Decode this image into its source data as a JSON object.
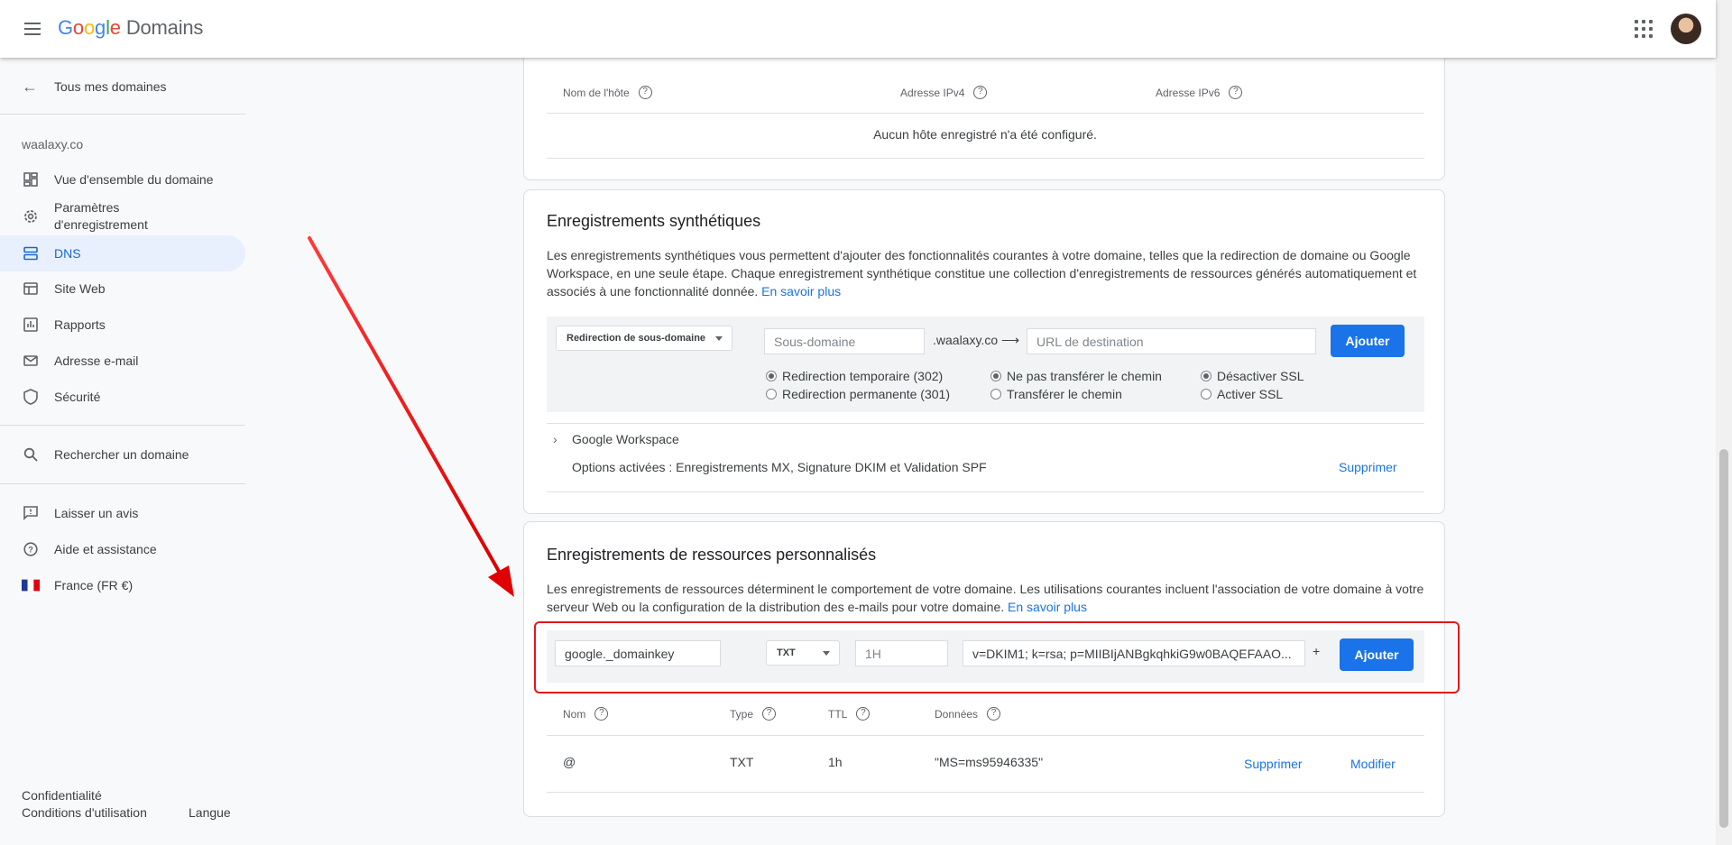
{
  "header": {
    "logo_brand": "Google",
    "logo_product": "Domains"
  },
  "sidebar": {
    "back_label": "Tous mes domaines",
    "domain": "waalaxy.co",
    "items": [
      {
        "label": "Vue d'ensemble du domaine",
        "icon": "dashboard-icon"
      },
      {
        "label": "Paramètres d'enregistrement",
        "icon": "gear-icon"
      },
      {
        "label": "DNS",
        "icon": "dns-icon",
        "active": true
      },
      {
        "label": "Site Web",
        "icon": "web-icon"
      },
      {
        "label": "Rapports",
        "icon": "reports-icon"
      },
      {
        "label": "Adresse e-mail",
        "icon": "mail-icon"
      },
      {
        "label": "Sécurité",
        "icon": "shield-icon"
      }
    ],
    "search_label": "Rechercher un domaine",
    "feedback_label": "Laisser un avis",
    "help_label": "Aide et assistance",
    "country_label": "France (FR €)",
    "footer": {
      "privacy": "Confidentialité",
      "terms": "Conditions d'utilisation",
      "language": "Langue"
    }
  },
  "hosts": {
    "columns": [
      "Nom de l'hôte",
      "Adresse IPv4",
      "Adresse IPv6"
    ],
    "empty_message": "Aucun hôte enregistré n'a été configuré."
  },
  "synthetic": {
    "title": "Enregistrements synthétiques",
    "description": "Les enregistrements synthétiques vous permettent d'ajouter des fonctionnalités courantes à votre domaine, telles que la redirection de domaine ou Google Workspace, en une seule étape. Chaque enregistrement synthétique constitue une collection d'enregistrements de ressources générés automatiquement et associés à une fonctionnalité donnée.",
    "learn_more": "En savoir plus",
    "type_select": "Redirection de sous-domaine",
    "subdomain_placeholder": "Sous-domaine",
    "domain_suffix": ".waalaxy.co ⟶",
    "destination_placeholder": "URL de destination",
    "add_button": "Ajouter",
    "radios": {
      "temp": "Redirection temporaire (302)",
      "perm": "Redirection permanente (301)",
      "no_path": "Ne pas transférer le chemin",
      "path": "Transférer le chemin",
      "ssl_off": "Désactiver SSL",
      "ssl_on": "Activer SSL"
    },
    "workspace_label": "Google Workspace",
    "workspace_options": "Options activées : Enregistrements MX, Signature DKIM et Validation SPF",
    "delete_label": "Supprimer"
  },
  "custom": {
    "title": "Enregistrements de ressources personnalisés",
    "description": "Les enregistrements de ressources déterminent le comportement de votre domaine. Les utilisations courantes incluent l'association de votre domaine à votre serveur Web ou la configuration de la distribution des e-mails pour votre domaine.",
    "learn_more": "En savoir plus",
    "name_value": "google._domainkey",
    "type_value": "TXT",
    "ttl_placeholder": "1H",
    "data_value": "v=DKIM1; k=rsa; p=MIIBIjANBgkqhkiG9w0BAQEFAAO...",
    "plus": "+",
    "add_button": "Ajouter",
    "columns": [
      "Nom",
      "Type",
      "TTL",
      "Données"
    ],
    "rows": [
      {
        "name": "@",
        "type": "TXT",
        "ttl": "1h",
        "data": "\"MS=ms95946335\"",
        "delete": "Supprimer",
        "edit": "Modifier"
      }
    ]
  },
  "colors": {
    "accent": "#1a73e8",
    "annotation": "#e0191f"
  }
}
